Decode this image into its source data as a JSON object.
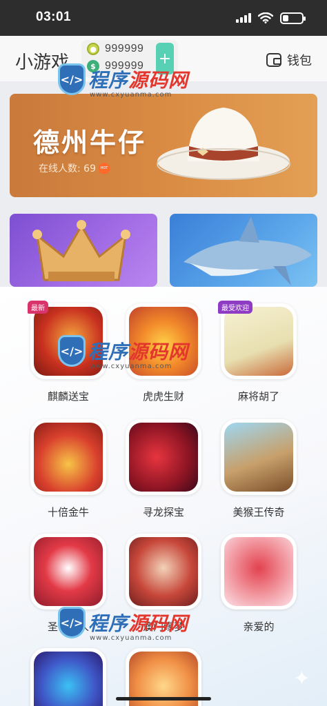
{
  "status_bar": {
    "time": "03:01"
  },
  "header": {
    "title": "小游戏",
    "balance_gold": "999999",
    "balance_cash": "999999",
    "add_label": "+",
    "wallet_label": "钱包"
  },
  "banner": {
    "title": "德州牛仔",
    "online_label": "在线人数: 69",
    "hot_badge": "HOT"
  },
  "games": [
    {
      "name": "麒麟送宝",
      "tag": "最新"
    },
    {
      "name": "虎虎生财",
      "tag": ""
    },
    {
      "name": "麻将胡了",
      "tag": "最受欢迎"
    },
    {
      "name": "十倍金牛",
      "tag": ""
    },
    {
      "name": "寻龙探宝",
      "tag": ""
    },
    {
      "name": "美猴王传奇",
      "tag": ""
    },
    {
      "name": "圣诞老人",
      "tag": ""
    },
    {
      "name": "澳门缘梦",
      "tag": ""
    },
    {
      "name": "亲爱的",
      "tag": ""
    },
    {
      "name": "",
      "tag": ""
    },
    {
      "name": "",
      "tag": ""
    }
  ],
  "watermark": {
    "text_a": "程序",
    "text_b": "源码网",
    "url": "www.cxyuanma.com"
  },
  "colors": {
    "accent": "#58d0b4",
    "banner_orange": "#d98b43",
    "tag_red": "#d8336a"
  }
}
